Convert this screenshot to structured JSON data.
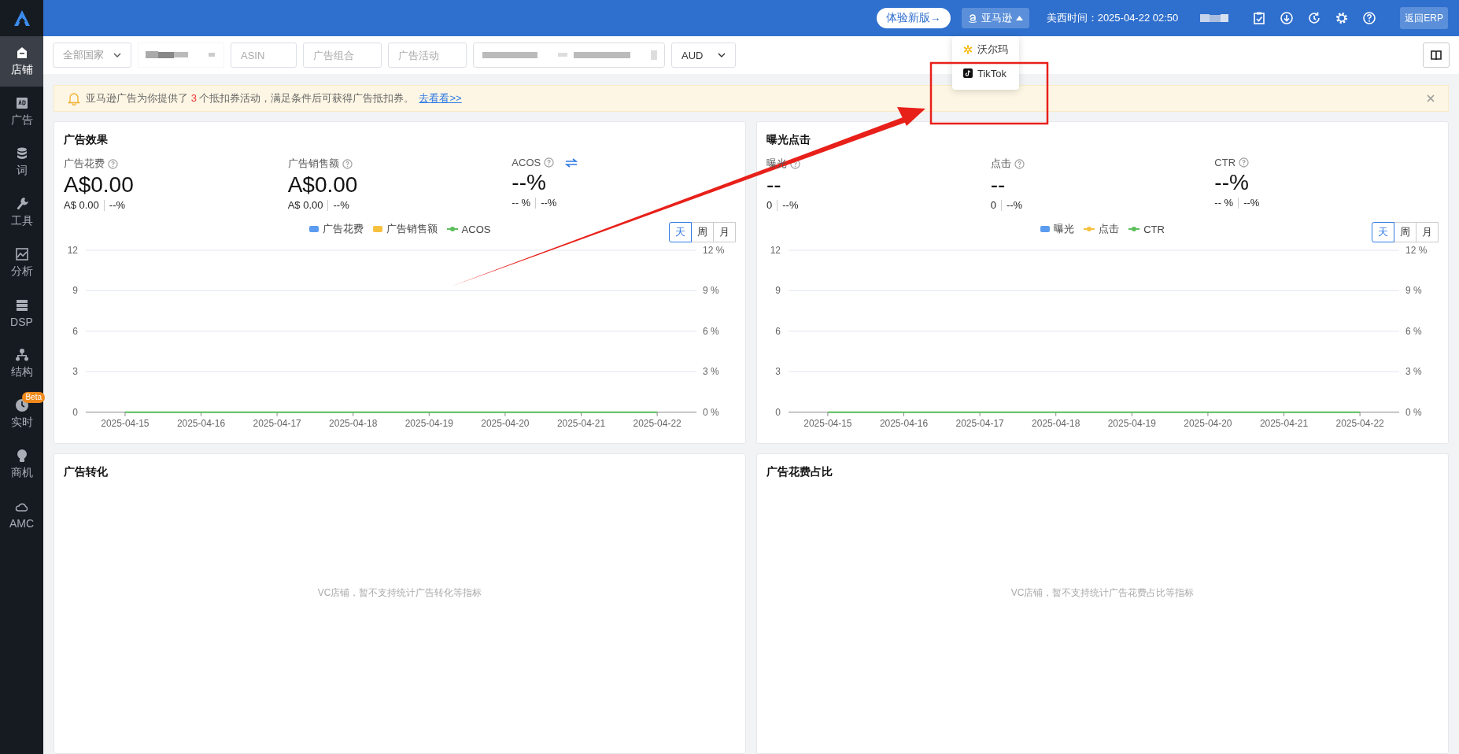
{
  "sidebar": {
    "items": [
      {
        "label": "店铺",
        "selected": true
      },
      {
        "label": "广告",
        "selected": false
      },
      {
        "label": "词",
        "selected": false
      },
      {
        "label": "工具",
        "selected": false
      },
      {
        "label": "分析",
        "selected": false
      },
      {
        "label": "DSP",
        "selected": false
      },
      {
        "label": "结构",
        "selected": false
      },
      {
        "label": "实时",
        "selected": false,
        "badge": "Beta"
      },
      {
        "label": "商机",
        "selected": false
      },
      {
        "label": "AMC",
        "selected": false
      }
    ]
  },
  "topbar": {
    "new_version_button": "体验新版→",
    "platform_button": "亚马逊",
    "time": "美西时间：2025-04-22 02:50",
    "erp_button": "返回ERP"
  },
  "platform_menu": [
    {
      "label": "沃尔玛",
      "kind": "walmart"
    },
    {
      "label": "TikTok",
      "kind": "tiktok"
    }
  ],
  "filters": {
    "country": "全部国家",
    "asin": {
      "placeholder": "ASIN"
    },
    "ad_group": {
      "placeholder": "广告组合"
    },
    "campaign": {
      "placeholder": "广告活动"
    },
    "currency": "AUD"
  },
  "notice": {
    "prefix": "亚马逊广告为你提供了",
    "count": "3",
    "suffix": "个抵扣券活动，满足条件后可获得广告抵扣券。",
    "link": "去看看>>"
  },
  "panels": [
    {
      "title": "广告效果",
      "metrics": [
        {
          "label": "广告花费",
          "value": "A$0.00",
          "sub_value": "A$ 0.00",
          "sub_change": "--%",
          "switchable": false
        },
        {
          "label": "广告销售额",
          "value": "A$0.00",
          "sub_value": "A$ 0.00",
          "sub_change": "--%",
          "switchable": false
        },
        {
          "label": "ACOS",
          "value": "--%",
          "sub_value": "-- %",
          "sub_change": "--%",
          "switchable": true
        }
      ],
      "legend_markers": [
        {
          "kind": "bar"
        },
        {
          "kind": "bar"
        },
        {
          "kind": "line"
        }
      ],
      "periods": [
        {
          "label": "天",
          "selected": true
        },
        {
          "label": "周",
          "selected": false
        },
        {
          "label": "月",
          "selected": false
        }
      ],
      "right_axis_labels": [
        "12 %",
        "9 %",
        "6 %",
        "3 %",
        "0 %"
      ],
      "chart_data": {
        "type": "line",
        "categories": [
          "2025-04-15",
          "2025-04-16",
          "2025-04-17",
          "2025-04-18",
          "2025-04-19",
          "2025-04-20",
          "2025-04-21",
          "2025-04-22"
        ],
        "ylim": [
          0,
          12
        ],
        "yticks": [
          0,
          3,
          6,
          9,
          12
        ],
        "grid": true,
        "series": [
          {
            "name": "广告花费",
            "color": "#5b9cf0",
            "values": [
              null,
              null,
              null,
              null,
              null,
              null,
              null,
              null
            ]
          },
          {
            "name": "广告销售额",
            "color": "#f7c140",
            "values": [
              null,
              null,
              null,
              null,
              null,
              null,
              null,
              null
            ]
          },
          {
            "name": "ACOS",
            "color": "#5cbf5c",
            "values": [
              0,
              0,
              0,
              0,
              0,
              0,
              0,
              0
            ]
          }
        ]
      }
    },
    {
      "title": "曝光点击",
      "metrics": [
        {
          "label": "曝光",
          "value": "--",
          "sub_value": "0",
          "sub_change": "--%",
          "switchable": false
        },
        {
          "label": "点击",
          "value": "--",
          "sub_value": "0",
          "sub_change": "--%",
          "switchable": false
        },
        {
          "label": "CTR",
          "value": "--%",
          "sub_value": "-- %",
          "sub_change": "--%",
          "switchable": false
        }
      ],
      "legend_markers": [
        {
          "kind": "bar"
        },
        {
          "kind": "line"
        },
        {
          "kind": "line"
        }
      ],
      "periods": [
        {
          "label": "天",
          "selected": true
        },
        {
          "label": "周",
          "selected": false
        },
        {
          "label": "月",
          "selected": false
        }
      ],
      "right_axis_labels": [
        "12 %",
        "9 %",
        "6 %",
        "3 %",
        "0 %"
      ],
      "chart_data": {
        "type": "line",
        "categories": [
          "2025-04-15",
          "2025-04-16",
          "2025-04-17",
          "2025-04-18",
          "2025-04-19",
          "2025-04-20",
          "2025-04-21",
          "2025-04-22"
        ],
        "ylim": [
          0,
          12
        ],
        "yticks": [
          0,
          3,
          6,
          9,
          12
        ],
        "grid": true,
        "series": [
          {
            "name": "曝光",
            "color": "#5b9cf0",
            "values": [
              null,
              null,
              null,
              null,
              null,
              null,
              null,
              null
            ]
          },
          {
            "name": "点击",
            "color": "#f7c140",
            "values": [
              null,
              null,
              null,
              null,
              null,
              null,
              null,
              null
            ]
          },
          {
            "name": "CTR",
            "color": "#5cbf5c",
            "values": [
              0,
              0,
              0,
              0,
              0,
              0,
              0,
              0
            ]
          }
        ]
      }
    }
  ],
  "empty_panels": [
    {
      "title": "广告转化",
      "message": "VC店铺，暂不支持统计广告转化等指标"
    },
    {
      "title": "广告花费占比",
      "message": "VC店铺，暂不支持统计广告花费占比等指标"
    }
  ]
}
